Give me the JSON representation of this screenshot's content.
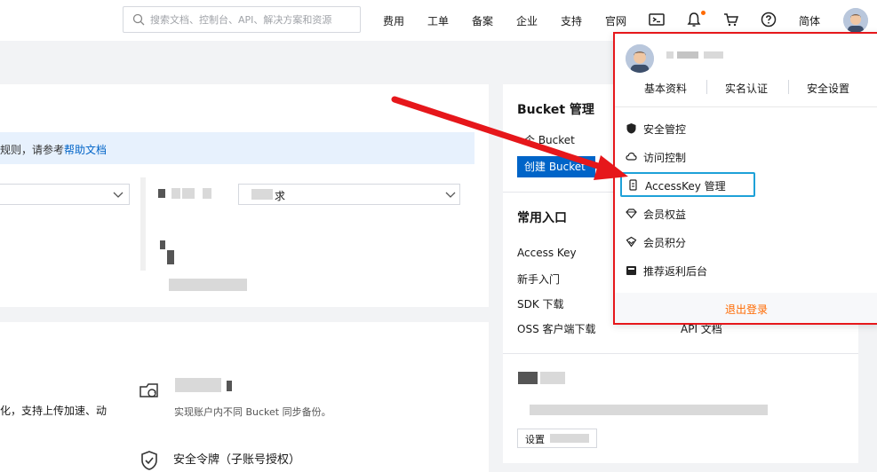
{
  "header": {
    "search_placeholder": "搜索文档、控制台、API、解决方案和资源",
    "nav": [
      "费用",
      "工单",
      "备案",
      "企业",
      "支持",
      "官网"
    ],
    "lang": "简体"
  },
  "main": {
    "notice_text": "规则，请参考",
    "notice_link": "帮助文档",
    "select_right_label": "求",
    "upload_text": "化，支持上传加速、动",
    "sync_text": "实现账户内不同                Bucket 同步备份。",
    "token_title": "安全令牌（子账号授权）"
  },
  "side": {
    "bucket_title": "Bucket 管理",
    "bucket_count_label": "个 Bucket",
    "create_bucket": "创建 Bucket",
    "common_title": "常用入口",
    "entries": [
      "Access Key",
      "新手入门",
      "SDK 下载",
      "OSS 客户端下载"
    ],
    "api_doc": "API 文档",
    "setting_button": "设置"
  },
  "user_menu": {
    "tabs": [
      "基本资料",
      "实名认证",
      "安全设置"
    ],
    "items": [
      {
        "label": "安全管控",
        "icon": "shield-icon"
      },
      {
        "label": "访问控制",
        "icon": "cloud-icon"
      },
      {
        "label": "AccessKey 管理",
        "icon": "key-icon"
      },
      {
        "label": "会员权益",
        "icon": "diamond-icon"
      },
      {
        "label": "会员积分",
        "icon": "gem-icon"
      },
      {
        "label": "推荐返利后台",
        "icon": "wallet-icon"
      }
    ],
    "logout": "退出登录"
  },
  "colors": {
    "accent": "#ff6a00",
    "primary": "#0064c8",
    "annotation_red": "#e6171b",
    "highlight": "#1ea1d8"
  }
}
